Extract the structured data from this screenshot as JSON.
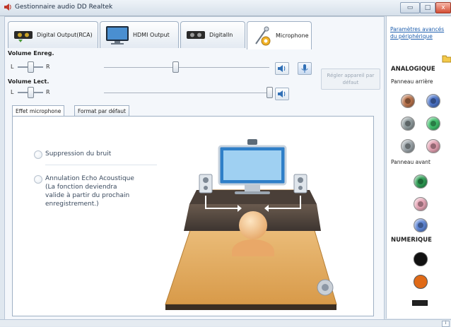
{
  "window": {
    "title": "Gestionnaire audio DD Realtek",
    "minimize_glyph": "▭",
    "maximize_glyph": "□",
    "close_glyph": "x"
  },
  "device_tabs": [
    {
      "label": "Digital Output(RCA)",
      "icon": "digital-output-rca-icon"
    },
    {
      "label": "HDMI Output",
      "icon": "monitor-icon"
    },
    {
      "label": "DigitalIn",
      "icon": "digital-input-icon"
    },
    {
      "label": "Microphone",
      "icon": "microphone-icon",
      "active": true
    }
  ],
  "volume_record": {
    "label": "Volume Enreg.",
    "left": "L",
    "right": "R",
    "balance": 0.5,
    "level": 0.43
  },
  "volume_play": {
    "label": "Volume Lect.",
    "left": "L",
    "right": "R",
    "balance": 0.5,
    "level": 1.0
  },
  "set_default_button": "Régler appareil par défaut",
  "sub_tabs": [
    {
      "label": "Effet microphone",
      "active": true
    },
    {
      "label": "Format par défaut",
      "active": false
    }
  ],
  "options": {
    "noise_suppression": "Suppression du bruit",
    "echo_cancel_line1": "Annulation Echo Acoustique",
    "echo_cancel_line2": "(La fonction deviendra",
    "echo_cancel_line3": "valide à partir du prochain",
    "echo_cancel_line4": "enregistrement.)"
  },
  "right_panel": {
    "advanced_link_line1": "Paramètres avancés",
    "advanced_link_line2": "du périphérique",
    "analog_title": "ANALOGIQUE",
    "rear_panel": "Panneau arrière",
    "front_panel": "Panneau avant",
    "digital_title": "NUMERIQUE"
  },
  "jack_colors": {
    "rear": [
      "#b9734c",
      "#4d75c9",
      "#8f9b9d",
      "#3fbf6b",
      "#9aa3a8",
      "#e3a0b1"
    ],
    "front": [
      "#2f9e55",
      "#e8a6b7",
      "#5e86d6"
    ],
    "digital": [
      "#111111",
      "#e06a17"
    ]
  }
}
